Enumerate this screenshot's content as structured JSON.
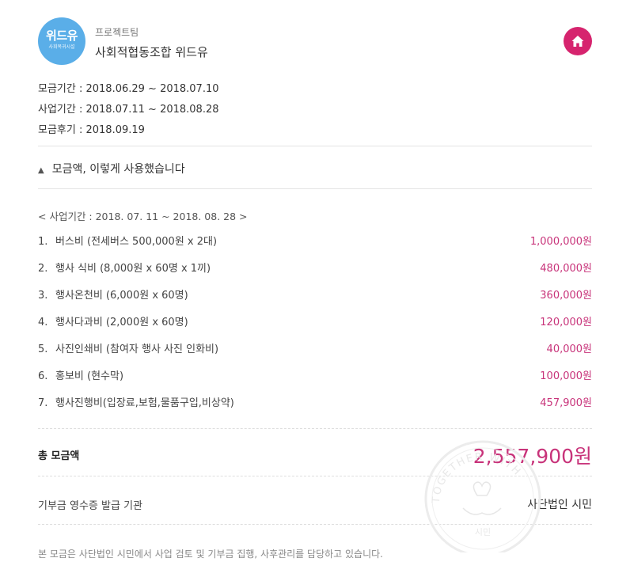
{
  "header": {
    "logo_text": "위드유",
    "logo_sub": "사회복귀시설",
    "team_label": "프로젝트팀",
    "team_name": "사회적협동조합 위드유"
  },
  "dates": {
    "fundraising": "모금기간 : 2018.06.29 ~ 2018.07.10",
    "project": "사업기간 : 2018.07.11 ~ 2018.08.28",
    "review": "모금후기 : 2018.09.19"
  },
  "usage": {
    "toggle_icon": "▲",
    "toggle_label": "모금액, 이렇게 사용했습니다",
    "period": "< 사업기간 : 2018. 07. 11 ~ 2018. 08. 28 >",
    "items": [
      {
        "num": "1.",
        "label": "버스비 (전세버스 500,000원 x 2대)",
        "amount": "1,000,000원"
      },
      {
        "num": "2.",
        "label": "행사 식비 (8,000원 x 60명 x 1끼)",
        "amount": "480,000원"
      },
      {
        "num": "3.",
        "label": "행사온천비 (6,000원 x 60명)",
        "amount": "360,000원"
      },
      {
        "num": "4.",
        "label": "행사다과비 (2,000원 x 60명)",
        "amount": "120,000원"
      },
      {
        "num": "5.",
        "label": "사진인쇄비 (참여자 행사 사진 인화비)",
        "amount": "40,000원"
      },
      {
        "num": "6.",
        "label": "홍보비 (현수막)",
        "amount": "100,000원"
      },
      {
        "num": "7.",
        "label": "행사진행비(입장료,보험,물품구입,비상약)",
        "amount": "457,900원"
      }
    ]
  },
  "total": {
    "label": "총 모금액",
    "amount": "2,557,900원"
  },
  "receipt": {
    "label": "기부금 영수증 발급 기관",
    "value": "사단법인 시민"
  },
  "footer": "본 모금은 사단법인 시민에서 사업 검토 및 기부금 집행, 사후관리를 담당하고 있습니다.",
  "stamp": {
    "text": "TOGETHER WITH",
    "sub": "시민"
  },
  "colors": {
    "accent": "#d6246e",
    "amount": "#c8337a",
    "logo_bg": "#5aaee8"
  },
  "icons": {
    "home": "home-icon"
  }
}
